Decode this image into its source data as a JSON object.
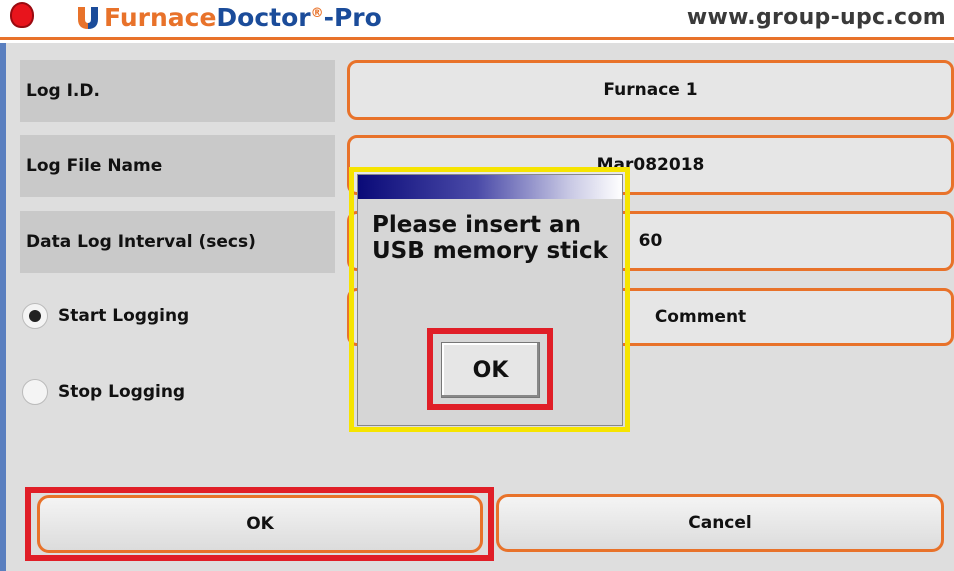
{
  "header": {
    "brand_part1": "Furnace",
    "brand_part2": "Doctor",
    "brand_reg": "®",
    "brand_part3": "-Pro",
    "website": "www.group-upc.com"
  },
  "form": {
    "log_id_label": "Log I.D.",
    "log_id_value": "Furnace 1",
    "log_file_label": "Log File Name",
    "log_file_value": "Mar082018",
    "interval_label": "Data Log Interval (secs)",
    "interval_value": "60",
    "comment_label": "Comment",
    "start_logging": "Start Logging",
    "stop_logging": "Stop Logging",
    "start_selected": true
  },
  "buttons": {
    "ok": "OK",
    "cancel": "Cancel"
  },
  "dialog": {
    "message": "Please insert an USB memory stick",
    "ok": "OK"
  },
  "colors": {
    "accent_orange": "#e8722a",
    "brand_blue": "#1b4c9a",
    "highlight_red": "#e01e27",
    "highlight_yellow": "#f6e400"
  }
}
